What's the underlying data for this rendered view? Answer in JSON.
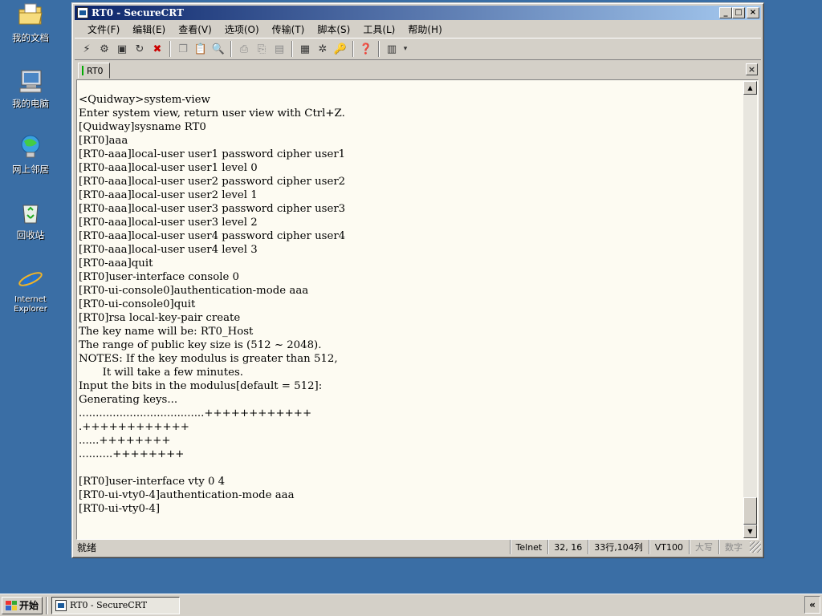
{
  "desktop": {
    "icons": [
      {
        "label": "我的文档",
        "icon": "folder-documents-icon"
      },
      {
        "label": "我的电脑",
        "icon": "computer-icon"
      },
      {
        "label": "网上邻居",
        "icon": "network-icon"
      },
      {
        "label": "回收站",
        "icon": "recycle-bin-icon"
      },
      {
        "label": "Internet Explorer",
        "icon": "internet-explorer-icon"
      }
    ]
  },
  "window": {
    "title": "RT0 - SecureCRT",
    "controls": {
      "minimize": "_",
      "maximize": "□",
      "close": "×"
    },
    "menu": [
      "文件(F)",
      "编辑(E)",
      "查看(V)",
      "选项(O)",
      "传输(T)",
      "脚本(S)",
      "工具(L)",
      "帮助(H)"
    ],
    "tab": {
      "label": "RT0",
      "close": "×"
    },
    "terminal_lines": [
      "<Quidway>system-view",
      "Enter system view, return user view with Ctrl+Z.",
      "[Quidway]sysname RT0",
      "[RT0]aaa",
      "[RT0-aaa]local-user user1 password cipher user1",
      "[RT0-aaa]local-user user1 level 0",
      "[RT0-aaa]local-user user2 password cipher user2",
      "[RT0-aaa]local-user user2 level 1",
      "[RT0-aaa]local-user user3 password cipher user3",
      "[RT0-aaa]local-user user3 level 2",
      "[RT0-aaa]local-user user4 password cipher user4",
      "[RT0-aaa]local-user user4 level 3",
      "[RT0-aaa]quit",
      "[RT0]user-interface console 0",
      "[RT0-ui-console0]authentication-mode aaa",
      "[RT0-ui-console0]quit",
      "[RT0]rsa local-key-pair create",
      "The key name will be: RT0_Host",
      "The range of public key size is (512 ~ 2048).",
      "NOTES: If the key modulus is greater than 512,",
      "       It will take a few minutes.",
      "Input the bits in the modulus[default = 512]:",
      "Generating keys...",
      ".....................................++++++++++++",
      ".++++++++++++",
      "......++++++++",
      "..........++++++++",
      "",
      "[RT0]user-interface vty 0 4",
      "[RT0-ui-vty0-4]authentication-mode aaa",
      "[RT0-ui-vty0-4]"
    ],
    "status": {
      "left": "就绪",
      "protocol": "Telnet",
      "cursor": "32,  16",
      "size": "33行,104列",
      "terminal": "VT100",
      "caps": "大写",
      "num": "数字"
    }
  },
  "taskbar": {
    "start_label": "开始",
    "task_label": "RT0 - SecureCRT",
    "tray_label": "«"
  }
}
